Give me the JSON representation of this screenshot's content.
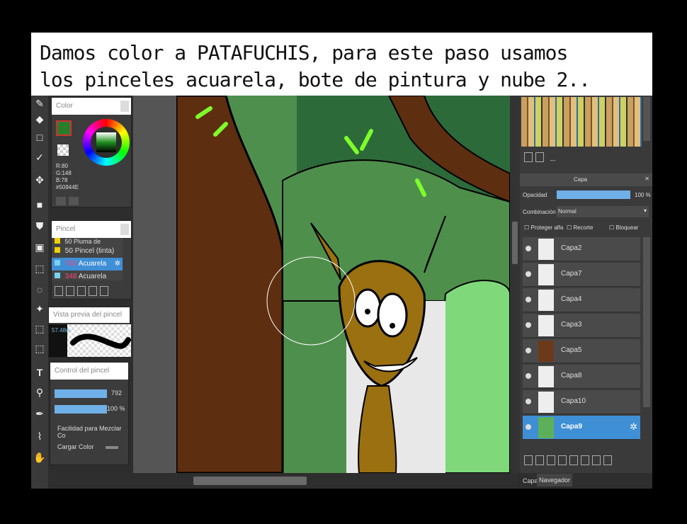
{
  "caption": {
    "line1": "Damos color a PATAFUCHIS, para este paso usamos",
    "line2": "los pinceles acuarela, bote de pintura y nube 2.."
  },
  "color_panel": {
    "title": "Color",
    "r": "R:80",
    "g": "G:148",
    "b": "B:78",
    "hex": "#50944E"
  },
  "brush_panel": {
    "title": "Pincel",
    "items": [
      {
        "size": "50",
        "name": "Pluma de punteado"
      },
      {
        "size": "50",
        "name": "Pincel (tinta)"
      },
      {
        "size": "792",
        "name": "Acuarela"
      },
      {
        "size": "348",
        "name": "Acuarela (acuoso)"
      }
    ]
  },
  "preview_panel": {
    "title": "Vista previa del pincel",
    "size": "57.48m"
  },
  "control_panel": {
    "title": "Control del pincel",
    "size_value": "792",
    "opacity_value": "100 %",
    "mix_label": "Facilidad para Mezclar Co",
    "load_label": "Cargar Color"
  },
  "layer_panel": {
    "title": "Capa",
    "opacity_label": "Opacidad",
    "opacity_value": "100 %",
    "blend_label": "Combinación",
    "blend_value": "Normal",
    "protect_alpha": "Proteger alfa",
    "clip": "Recorte",
    "lock": "Bloquear",
    "layers": [
      "Capa2",
      "Capa7",
      "Capa4",
      "Capa3",
      "Capa5",
      "Capa8",
      "Capa10",
      "Capa9"
    ],
    "selected": "Capa9",
    "tabs": [
      "Capa",
      "Navegador"
    ],
    "swatch_dash": "---"
  },
  "colors": {
    "accent": "#3f8fd6",
    "brush_color": "#50944E"
  }
}
